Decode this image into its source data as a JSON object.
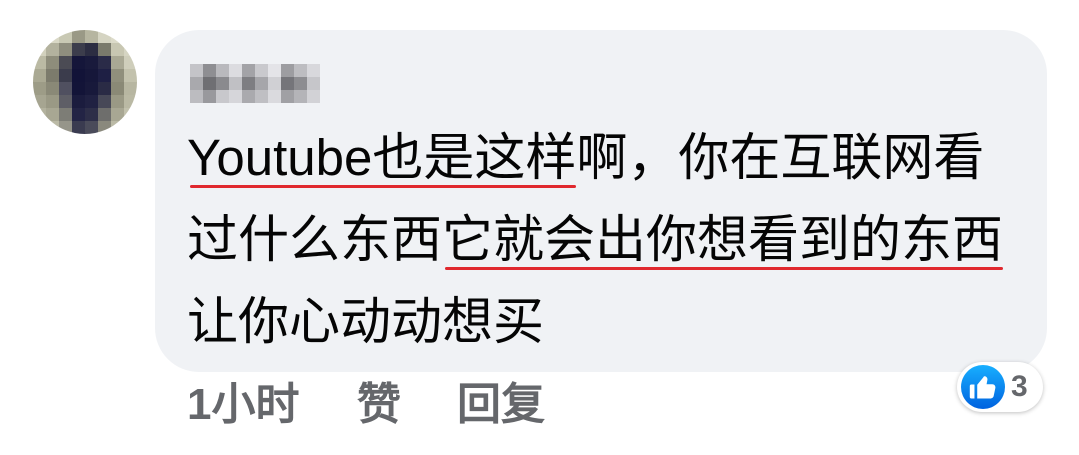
{
  "avatar": {
    "icon": "avatar-image"
  },
  "comment": {
    "lines": [
      [
        {
          "text": "Youtube也是这样",
          "underlined": true
        },
        {
          "text": "啊，你在互联网看",
          "underlined": false
        }
      ],
      [
        {
          "text": "过什么东西",
          "underlined": false
        },
        {
          "text": "它就会出你想看到的东西",
          "underlined": true
        }
      ],
      [
        {
          "text": "让你心动动想买",
          "underlined": false
        }
      ]
    ]
  },
  "actions": {
    "timestamp": "1小时",
    "like_label": "赞",
    "reply_label": "回复"
  },
  "reactions": {
    "icon": "like-icon",
    "count": "3"
  },
  "colors": {
    "bubble": "#f0f2f5",
    "text": "#050505",
    "meta": "#65676b",
    "annotation_underline": "#e0282e",
    "like_blue": "#1877f2"
  }
}
